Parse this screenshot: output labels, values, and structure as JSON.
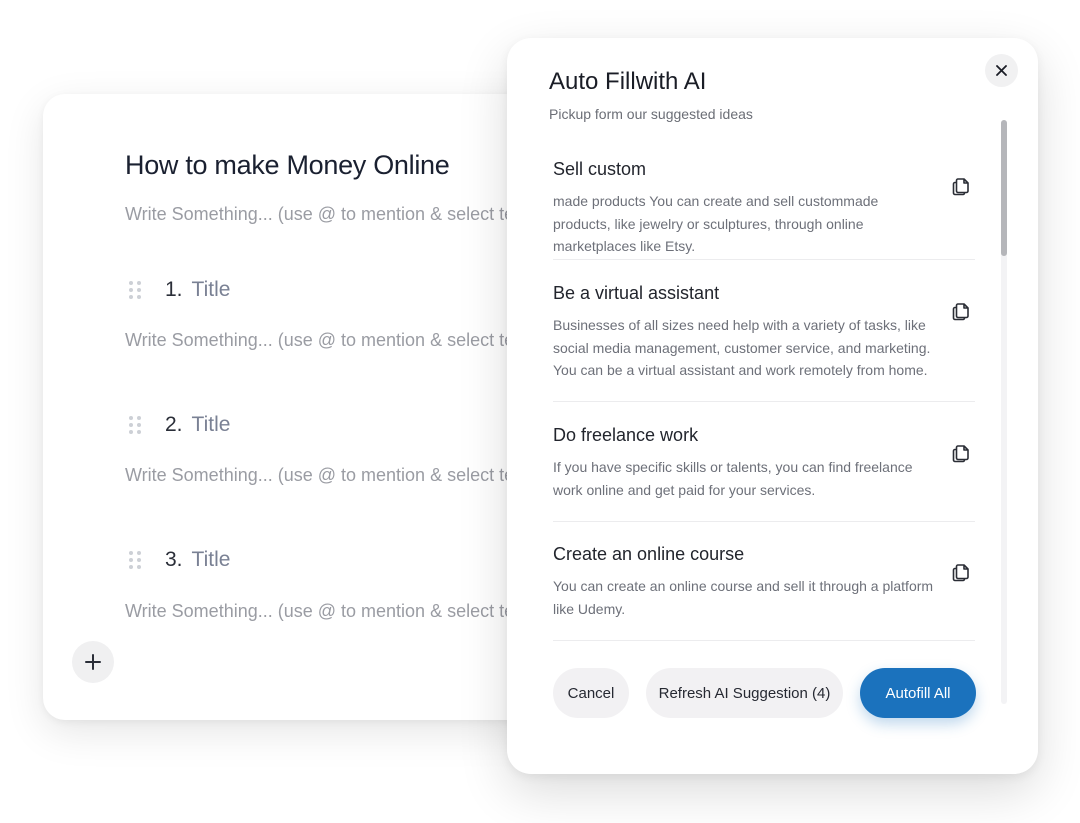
{
  "editor": {
    "title": "How to make Money Online",
    "placeholder": "Write Something... (use @ to mention & select text",
    "sections": [
      {
        "number": "1.",
        "title": "Title"
      },
      {
        "number": "2.",
        "title": "Title"
      },
      {
        "number": "3.",
        "title": "Title"
      }
    ],
    "add_icon": "plus-icon"
  },
  "modal": {
    "title": "Auto Fillwith AI",
    "subtitle": "Pickup form our suggested ideas",
    "close_icon": "close-icon",
    "suggestions": [
      {
        "title": "Sell custom",
        "description": "made products You can create and sell custommade products, like jewelry or sculptures, through online marketplaces like Etsy.",
        "icon": "copy-icon"
      },
      {
        "title": "Be a virtual assistant",
        "description": "Businesses of all sizes need help with a variety of tasks, like social media management, customer service, and marketing. You can be a virtual assistant and work remotely from home.",
        "icon": "copy-icon"
      },
      {
        "title": "Do freelance work",
        "description": "If you have specific skills or talents, you can find freelance work online and get paid for your services.",
        "icon": "copy-icon"
      },
      {
        "title": "Create an online course",
        "description": "You can create an online course and sell it through a platform like Udemy.",
        "icon": "copy-icon"
      }
    ],
    "buttons": {
      "cancel": "Cancel",
      "refresh": "Refresh AI Suggestion (4)",
      "autofill": "Autofill All"
    },
    "accent_color": "#1b72bd"
  }
}
